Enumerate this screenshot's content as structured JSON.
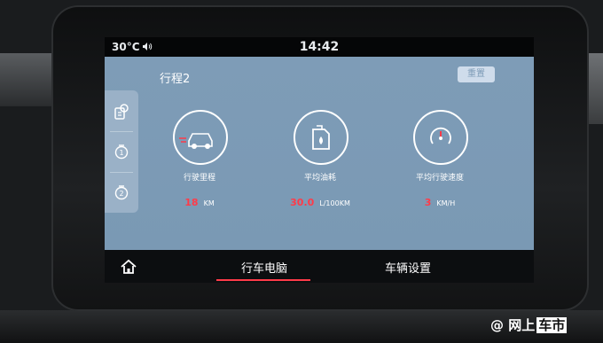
{
  "status_bar": {
    "temperature": "30°C",
    "time": "14:42"
  },
  "trip": {
    "title": "行程2",
    "reset_label": "重置"
  },
  "side_tabs": [
    {
      "icon": "trip-info-icon"
    },
    {
      "icon": "trip-1-icon"
    },
    {
      "icon": "trip-2-icon"
    }
  ],
  "metrics": [
    {
      "label": "行驶里程",
      "value": "18",
      "unit": "KM",
      "icon": "car-icon"
    },
    {
      "label": "平均油耗",
      "value": "30.0",
      "unit": "L/100KM",
      "icon": "fuel-can-icon"
    },
    {
      "label": "平均行驶速度",
      "value": "3",
      "unit": "KM/H",
      "icon": "speedometer-icon"
    }
  ],
  "nav": {
    "home_icon": "home-icon",
    "tab_trip_computer": "行车电脑",
    "tab_vehicle_settings": "车辆设置"
  },
  "watermark": {
    "prefix": "@ 网上",
    "mark": "车市"
  },
  "colors": {
    "content_bg": "#7e9cb7",
    "value_red": "#ff3b49",
    "active_tab_underline": "#ff3b49"
  }
}
